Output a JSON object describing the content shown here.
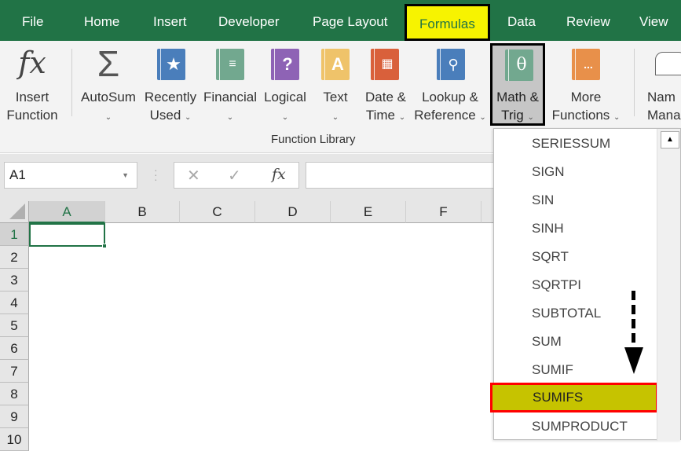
{
  "tabs": [
    "File",
    "Home",
    "Insert",
    "Developer",
    "Page Layout",
    "Formulas",
    "Data",
    "Review",
    "View"
  ],
  "active_tab": "Formulas",
  "ribbon": {
    "insert_function": {
      "line1": "Insert",
      "line2": "Function",
      "icon": "fx"
    },
    "autosum": {
      "line1": "AutoSum",
      "icon": "Σ"
    },
    "recently_used": {
      "line1": "Recently",
      "line2": "Used"
    },
    "financial": {
      "line1": "Financial"
    },
    "logical": {
      "line1": "Logical",
      "icon": "?"
    },
    "text": {
      "line1": "Text",
      "icon": "A"
    },
    "date_time": {
      "line1": "Date &",
      "line2": "Time"
    },
    "lookup": {
      "line1": "Lookup &",
      "line2": "Reference"
    },
    "math_trig": {
      "line1": "Math &",
      "line2": "Trig",
      "icon": "θ"
    },
    "more_functions": {
      "line1": "More",
      "line2": "Functions",
      "icon": "..."
    },
    "name_manager": {
      "line1": "Nam",
      "line2": "Mana"
    },
    "group_label": "Function Library",
    "chevron": "⌄",
    "colors": {
      "recently": "#4a7ebb",
      "financial": "#72a88f",
      "logical": "#8e63b5",
      "text": "#efc36a",
      "date": "#d9603b",
      "lookup": "#4a7ebb",
      "math": "#72a88f",
      "more": "#e8904a"
    }
  },
  "formula_bar": {
    "name_box": "A1",
    "cancel": "✕",
    "enter": "✓",
    "fx": "fx",
    "formula": ""
  },
  "columns": [
    "A",
    "B",
    "C",
    "D",
    "E",
    "F"
  ],
  "rows": [
    "1",
    "2",
    "3",
    "4",
    "5",
    "6",
    "7",
    "8",
    "9",
    "10"
  ],
  "selected_cell": "A1",
  "dropdown": {
    "items": [
      "SERIESSUM",
      "SIGN",
      "SIN",
      "SINH",
      "SQRT",
      "SQRTPI",
      "SUBTOTAL",
      "SUM",
      "SUMIF",
      "SUMIFS",
      "SUMPRODUCT"
    ],
    "highlighted": "SUMIFS",
    "scroll_up": "▲"
  }
}
